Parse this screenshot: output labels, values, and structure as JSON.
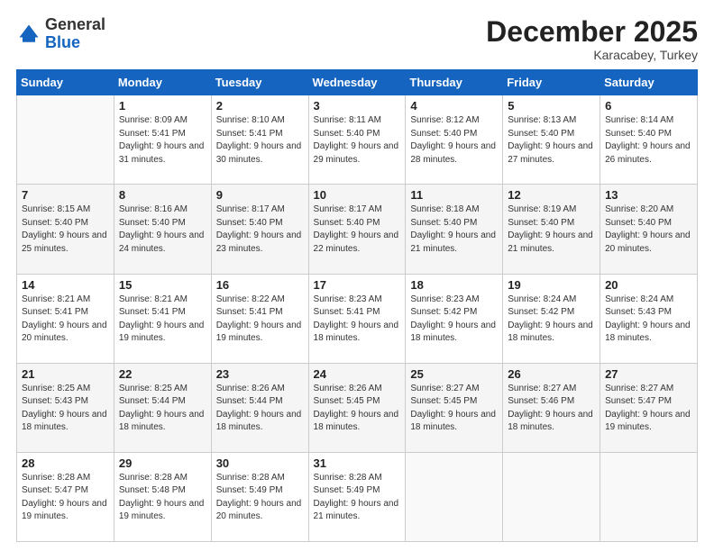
{
  "logo": {
    "general": "General",
    "blue": "Blue"
  },
  "header": {
    "month": "December 2025",
    "location": "Karacabey, Turkey"
  },
  "weekdays": [
    "Sunday",
    "Monday",
    "Tuesday",
    "Wednesday",
    "Thursday",
    "Friday",
    "Saturday"
  ],
  "weeks": [
    [
      {
        "day": "",
        "sunrise": "",
        "sunset": "",
        "daylight": ""
      },
      {
        "day": "1",
        "sunrise": "8:09 AM",
        "sunset": "5:41 PM",
        "daylight": "9 hours and 31 minutes."
      },
      {
        "day": "2",
        "sunrise": "8:10 AM",
        "sunset": "5:41 PM",
        "daylight": "9 hours and 30 minutes."
      },
      {
        "day": "3",
        "sunrise": "8:11 AM",
        "sunset": "5:40 PM",
        "daylight": "9 hours and 29 minutes."
      },
      {
        "day": "4",
        "sunrise": "8:12 AM",
        "sunset": "5:40 PM",
        "daylight": "9 hours and 28 minutes."
      },
      {
        "day": "5",
        "sunrise": "8:13 AM",
        "sunset": "5:40 PM",
        "daylight": "9 hours and 27 minutes."
      },
      {
        "day": "6",
        "sunrise": "8:14 AM",
        "sunset": "5:40 PM",
        "daylight": "9 hours and 26 minutes."
      }
    ],
    [
      {
        "day": "7",
        "sunrise": "8:15 AM",
        "sunset": "5:40 PM",
        "daylight": "9 hours and 25 minutes."
      },
      {
        "day": "8",
        "sunrise": "8:16 AM",
        "sunset": "5:40 PM",
        "daylight": "9 hours and 24 minutes."
      },
      {
        "day": "9",
        "sunrise": "8:17 AM",
        "sunset": "5:40 PM",
        "daylight": "9 hours and 23 minutes."
      },
      {
        "day": "10",
        "sunrise": "8:17 AM",
        "sunset": "5:40 PM",
        "daylight": "9 hours and 22 minutes."
      },
      {
        "day": "11",
        "sunrise": "8:18 AM",
        "sunset": "5:40 PM",
        "daylight": "9 hours and 21 minutes."
      },
      {
        "day": "12",
        "sunrise": "8:19 AM",
        "sunset": "5:40 PM",
        "daylight": "9 hours and 21 minutes."
      },
      {
        "day": "13",
        "sunrise": "8:20 AM",
        "sunset": "5:40 PM",
        "daylight": "9 hours and 20 minutes."
      }
    ],
    [
      {
        "day": "14",
        "sunrise": "8:21 AM",
        "sunset": "5:41 PM",
        "daylight": "9 hours and 20 minutes."
      },
      {
        "day": "15",
        "sunrise": "8:21 AM",
        "sunset": "5:41 PM",
        "daylight": "9 hours and 19 minutes."
      },
      {
        "day": "16",
        "sunrise": "8:22 AM",
        "sunset": "5:41 PM",
        "daylight": "9 hours and 19 minutes."
      },
      {
        "day": "17",
        "sunrise": "8:23 AM",
        "sunset": "5:41 PM",
        "daylight": "9 hours and 18 minutes."
      },
      {
        "day": "18",
        "sunrise": "8:23 AM",
        "sunset": "5:42 PM",
        "daylight": "9 hours and 18 minutes."
      },
      {
        "day": "19",
        "sunrise": "8:24 AM",
        "sunset": "5:42 PM",
        "daylight": "9 hours and 18 minutes."
      },
      {
        "day": "20",
        "sunrise": "8:24 AM",
        "sunset": "5:43 PM",
        "daylight": "9 hours and 18 minutes."
      }
    ],
    [
      {
        "day": "21",
        "sunrise": "8:25 AM",
        "sunset": "5:43 PM",
        "daylight": "9 hours and 18 minutes."
      },
      {
        "day": "22",
        "sunrise": "8:25 AM",
        "sunset": "5:44 PM",
        "daylight": "9 hours and 18 minutes."
      },
      {
        "day": "23",
        "sunrise": "8:26 AM",
        "sunset": "5:44 PM",
        "daylight": "9 hours and 18 minutes."
      },
      {
        "day": "24",
        "sunrise": "8:26 AM",
        "sunset": "5:45 PM",
        "daylight": "9 hours and 18 minutes."
      },
      {
        "day": "25",
        "sunrise": "8:27 AM",
        "sunset": "5:45 PM",
        "daylight": "9 hours and 18 minutes."
      },
      {
        "day": "26",
        "sunrise": "8:27 AM",
        "sunset": "5:46 PM",
        "daylight": "9 hours and 18 minutes."
      },
      {
        "day": "27",
        "sunrise": "8:27 AM",
        "sunset": "5:47 PM",
        "daylight": "9 hours and 19 minutes."
      }
    ],
    [
      {
        "day": "28",
        "sunrise": "8:28 AM",
        "sunset": "5:47 PM",
        "daylight": "9 hours and 19 minutes."
      },
      {
        "day": "29",
        "sunrise": "8:28 AM",
        "sunset": "5:48 PM",
        "daylight": "9 hours and 19 minutes."
      },
      {
        "day": "30",
        "sunrise": "8:28 AM",
        "sunset": "5:49 PM",
        "daylight": "9 hours and 20 minutes."
      },
      {
        "day": "31",
        "sunrise": "8:28 AM",
        "sunset": "5:49 PM",
        "daylight": "9 hours and 21 minutes."
      },
      {
        "day": "",
        "sunrise": "",
        "sunset": "",
        "daylight": ""
      },
      {
        "day": "",
        "sunrise": "",
        "sunset": "",
        "daylight": ""
      },
      {
        "day": "",
        "sunrise": "",
        "sunset": "",
        "daylight": ""
      }
    ]
  ]
}
